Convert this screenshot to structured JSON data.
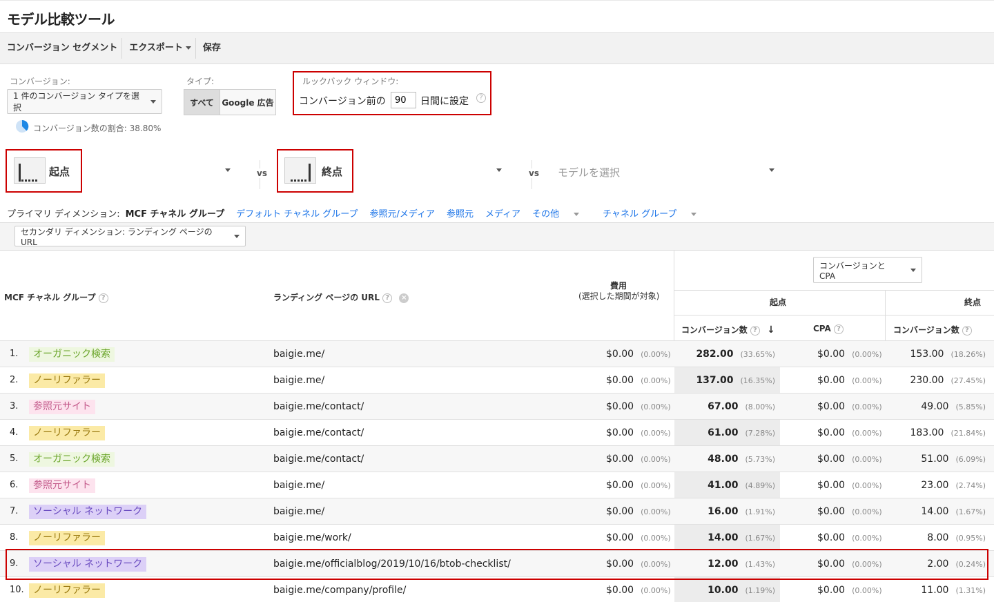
{
  "title": "モデル比較ツール",
  "toolbar": {
    "items": [
      "コンバージョン セグメント",
      "エクスポート",
      "保存"
    ]
  },
  "conversion": {
    "label": "コンバージョン:",
    "select": "1 件のコンバージョン タイプを選択",
    "share": "コンバージョン数の割合: 38.80%"
  },
  "type": {
    "label": "タイプ:",
    "all": "すべて",
    "google": "Google 広告"
  },
  "lookback": {
    "label": "ルックバック ウィンドウ:",
    "prefix": "コンバージョン前の",
    "value": "90",
    "suffix": "日間に設定"
  },
  "models": {
    "first": "起点",
    "last": "終点",
    "vs": "vs",
    "placeholder": "モデルを選択"
  },
  "primary_dim": {
    "label": "プライマリ ディメンション:",
    "current": "MCF チャネル グループ",
    "links": [
      "デフォルト チャネル グループ",
      "参照元/メディア",
      "参照元",
      "メディア",
      "その他",
      "チャネル グループ"
    ]
  },
  "secondary_dim": "セカンダリ ディメンション: ランディング ページの URL",
  "metric_select": "コンバージョンと CPA",
  "table": {
    "col_channel": "MCF チャネル グループ",
    "col_url": "ランディング ページの URL",
    "col_cost": "費用",
    "col_cost_sub": "(選択した期間が対象)",
    "group_first": "起点",
    "group_last": "終点",
    "col_conv": "コンバージョン数",
    "col_cpa": "CPA",
    "rows": [
      {
        "n": "1.",
        "ch": "オーガニック検索",
        "type": "organic",
        "url": "baigie.me/",
        "cost": "$0.00",
        "cost_p": "(0.00%)",
        "c1": "282.00",
        "c1p": "(33.65%)",
        "cpa": "$0.00",
        "cpap": "(0.00%)",
        "c2": "153.00",
        "c2p": "(18.26%)"
      },
      {
        "n": "2.",
        "ch": "ノーリファラー",
        "type": "direct",
        "url": "baigie.me/",
        "cost": "$0.00",
        "cost_p": "(0.00%)",
        "c1": "137.00",
        "c1p": "(16.35%)",
        "cpa": "$0.00",
        "cpap": "(0.00%)",
        "c2": "230.00",
        "c2p": "(27.45%)"
      },
      {
        "n": "3.",
        "ch": "参照元サイト",
        "type": "referral",
        "url": "baigie.me/contact/",
        "cost": "$0.00",
        "cost_p": "(0.00%)",
        "c1": "67.00",
        "c1p": "(8.00%)",
        "cpa": "$0.00",
        "cpap": "(0.00%)",
        "c2": "49.00",
        "c2p": "(5.85%)"
      },
      {
        "n": "4.",
        "ch": "ノーリファラー",
        "type": "direct",
        "url": "baigie.me/contact/",
        "cost": "$0.00",
        "cost_p": "(0.00%)",
        "c1": "61.00",
        "c1p": "(7.28%)",
        "cpa": "$0.00",
        "cpap": "(0.00%)",
        "c2": "183.00",
        "c2p": "(21.84%)"
      },
      {
        "n": "5.",
        "ch": "オーガニック検索",
        "type": "organic",
        "url": "baigie.me/contact/",
        "cost": "$0.00",
        "cost_p": "(0.00%)",
        "c1": "48.00",
        "c1p": "(5.73%)",
        "cpa": "$0.00",
        "cpap": "(0.00%)",
        "c2": "51.00",
        "c2p": "(6.09%)"
      },
      {
        "n": "6.",
        "ch": "参照元サイト",
        "type": "referral",
        "url": "baigie.me/",
        "cost": "$0.00",
        "cost_p": "(0.00%)",
        "c1": "41.00",
        "c1p": "(4.89%)",
        "cpa": "$0.00",
        "cpap": "(0.00%)",
        "c2": "23.00",
        "c2p": "(2.74%)"
      },
      {
        "n": "7.",
        "ch": "ソーシャル ネットワーク",
        "type": "social",
        "url": "baigie.me/",
        "cost": "$0.00",
        "cost_p": "(0.00%)",
        "c1": "16.00",
        "c1p": "(1.91%)",
        "cpa": "$0.00",
        "cpap": "(0.00%)",
        "c2": "14.00",
        "c2p": "(1.67%)"
      },
      {
        "n": "8.",
        "ch": "ノーリファラー",
        "type": "direct",
        "url": "baigie.me/work/",
        "cost": "$0.00",
        "cost_p": "(0.00%)",
        "c1": "14.00",
        "c1p": "(1.67%)",
        "cpa": "$0.00",
        "cpap": "(0.00%)",
        "c2": "8.00",
        "c2p": "(0.95%)"
      },
      {
        "n": "9.",
        "ch": "ソーシャル ネットワーク",
        "type": "social",
        "url": "baigie.me/officialblog/2019/10/16/btob-checklist/",
        "cost": "$0.00",
        "cost_p": "(0.00%)",
        "c1": "12.00",
        "c1p": "(1.43%)",
        "cpa": "$0.00",
        "cpap": "(0.00%)",
        "c2": "2.00",
        "c2p": "(0.24%)"
      },
      {
        "n": "10.",
        "ch": "ノーリファラー",
        "type": "direct",
        "url": "baigie.me/company/profile/",
        "cost": "$0.00",
        "cost_p": "(0.00%)",
        "c1": "10.00",
        "c1p": "(1.19%)",
        "cpa": "$0.00",
        "cpap": "(0.00%)",
        "c2": "11.00",
        "c2p": "(1.31%)"
      }
    ]
  }
}
